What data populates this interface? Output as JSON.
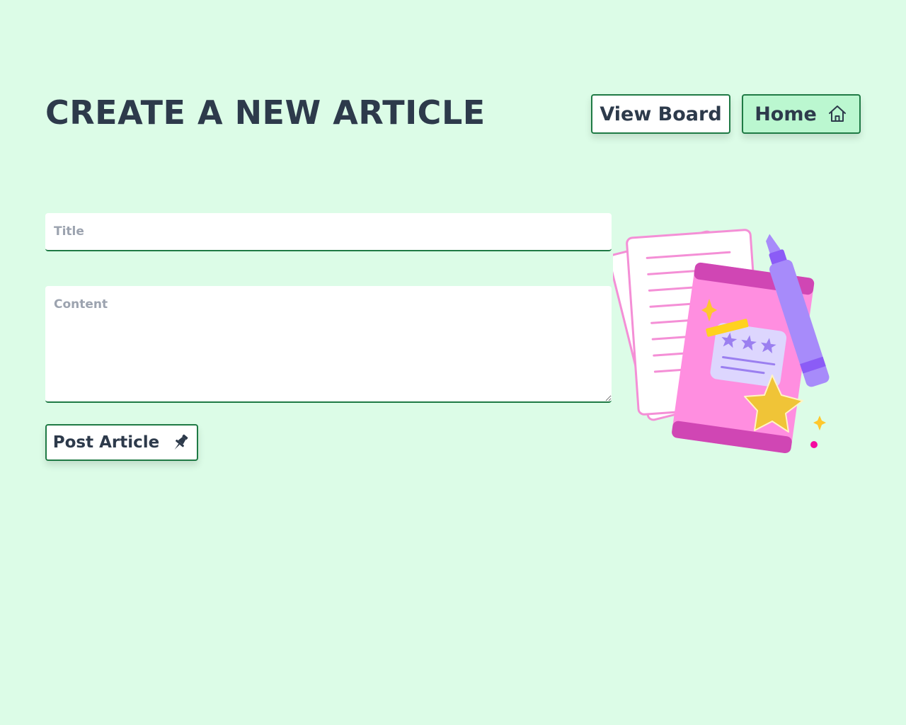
{
  "header": {
    "title": "CREATE A NEW ARTICLE",
    "view_board_label": "View Board",
    "home_label": "Home"
  },
  "form": {
    "title_placeholder": "Title",
    "content_placeholder": "Content",
    "post_label": "Post Article"
  },
  "icons": {
    "home": "home-icon",
    "post": "pushpin-icon",
    "illustration": "notebook-illustration"
  },
  "colors": {
    "background": "#dcfce7",
    "accent": "#1f7a45",
    "home_button": "#bbf7d0",
    "text": "#2d3a4b"
  }
}
